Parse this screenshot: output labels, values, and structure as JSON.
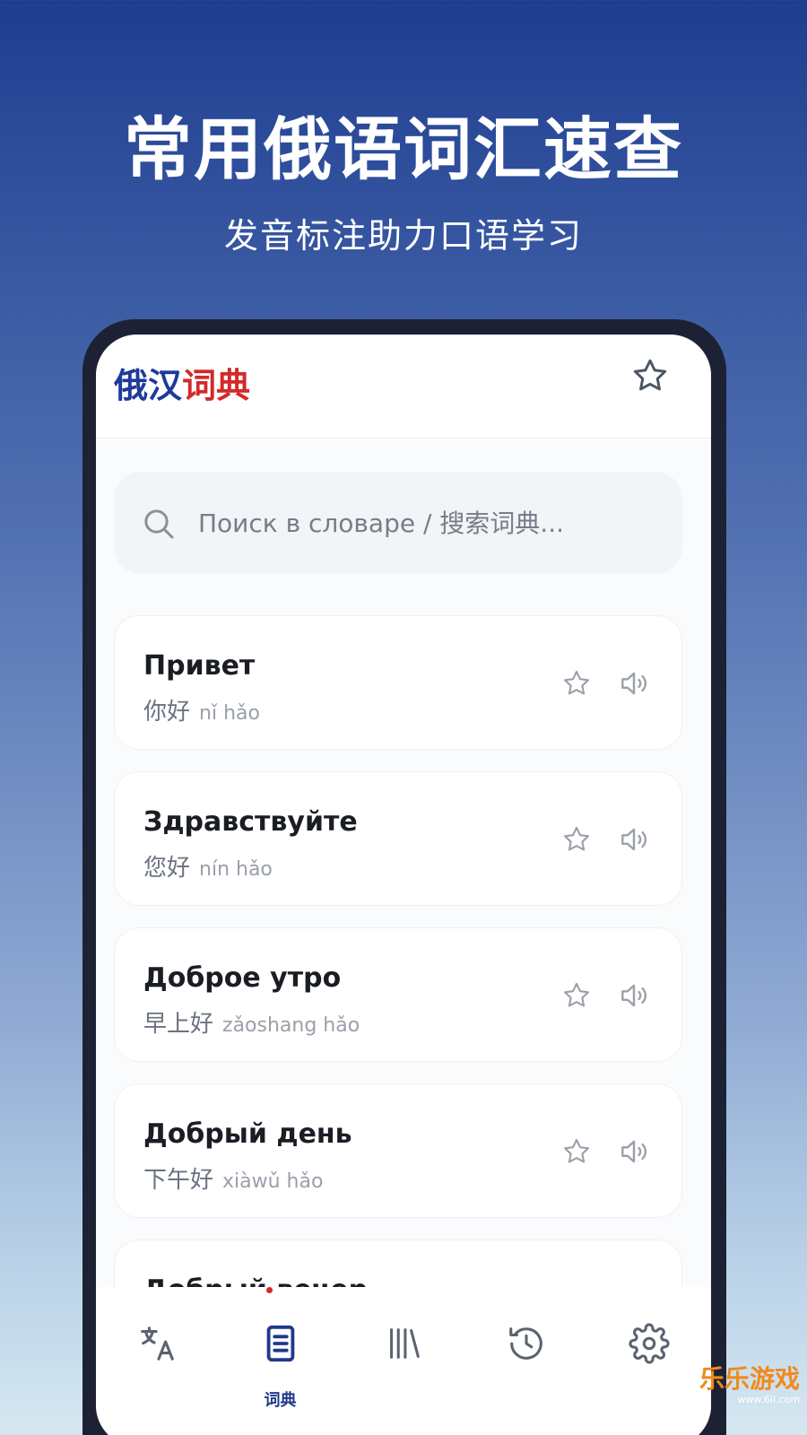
{
  "promo": {
    "headline": "常用俄语词汇速查",
    "subheadline": "发音标注助力口语学习"
  },
  "app": {
    "logo_part1": "俄汉",
    "logo_part2": "词典",
    "brand_blue": "#1e3a9a",
    "brand_red": "#d22a2a"
  },
  "search": {
    "placeholder": "Поиск в словаре / 搜索词典...",
    "value": ""
  },
  "entries": [
    {
      "word": "Привет",
      "translation": "你好",
      "pinyin": "nǐ hǎo"
    },
    {
      "word": "Здравствуйте",
      "translation": "您好",
      "pinyin": "nín hǎo"
    },
    {
      "word": "Доброе утро",
      "translation": "早上好",
      "pinyin": "zǎoshang hǎo"
    },
    {
      "word": "Добрый день",
      "translation": "下午好",
      "pinyin": "xiàwǔ hǎo"
    },
    {
      "word": "Добрый вечер",
      "translation": "",
      "pinyin": ""
    }
  ],
  "tabs": [
    {
      "id": "translate",
      "icon": "translate-icon",
      "label": ""
    },
    {
      "id": "dictionary",
      "icon": "book-icon",
      "label": "词典",
      "active": true
    },
    {
      "id": "library",
      "icon": "library-icon",
      "label": ""
    },
    {
      "id": "history",
      "icon": "history-icon",
      "label": ""
    },
    {
      "id": "settings",
      "icon": "gear-icon",
      "label": ""
    }
  ],
  "watermark": {
    "text": "乐乐游戏",
    "url": "www.6ll.com"
  }
}
